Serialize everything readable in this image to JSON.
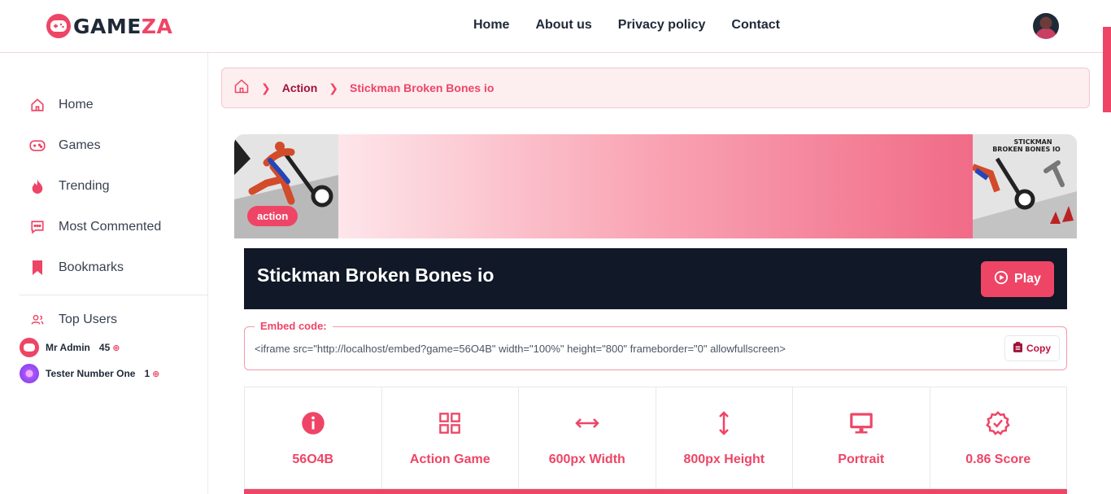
{
  "header": {
    "logo_part1": "GAME",
    "logo_part2": "ZA",
    "nav": [
      "Home",
      "About us",
      "Privacy policy",
      "Contact"
    ]
  },
  "sidebar": {
    "items": [
      {
        "label": "Home",
        "icon": "home-icon"
      },
      {
        "label": "Games",
        "icon": "gamepad-icon"
      },
      {
        "label": "Trending",
        "icon": "flame-icon"
      },
      {
        "label": "Most Commented",
        "icon": "comment-icon"
      },
      {
        "label": "Bookmarks",
        "icon": "bookmark-icon"
      }
    ],
    "top_users_label": "Top Users",
    "users": [
      {
        "name": "Mr Admin",
        "score": "45"
      },
      {
        "name": "Tester Number One",
        "score": "1"
      }
    ]
  },
  "breadcrumb": {
    "category": "Action",
    "current": "Stickman Broken Bones io"
  },
  "game": {
    "tag": "action",
    "title": "Stickman Broken Bones io",
    "play_label": "Play",
    "thumb_caption_line1": "STICKMAN",
    "thumb_caption_line2": "BROKEN BONES IO"
  },
  "embed": {
    "label": "Embed code:",
    "code": "<iframe src=\"http://localhost/embed?game=56O4B\" width=\"100%\" height=\"800\" frameborder=\"0\" allowfullscreen>",
    "copy_label": "Copy"
  },
  "stats": [
    {
      "icon": "info-icon",
      "value": "56O4B"
    },
    {
      "icon": "grid-icon",
      "value": "Action Game"
    },
    {
      "icon": "width-arrows-icon",
      "value": "600px Width"
    },
    {
      "icon": "height-arrows-icon",
      "value": "800px Height"
    },
    {
      "icon": "monitor-icon",
      "value": "Portrait"
    },
    {
      "icon": "badge-check-icon",
      "value": "0.86 Score"
    }
  ],
  "colors": {
    "accent": "#ee4566",
    "dark": "#111827",
    "breadcrumb_bg": "#fdeef0"
  }
}
